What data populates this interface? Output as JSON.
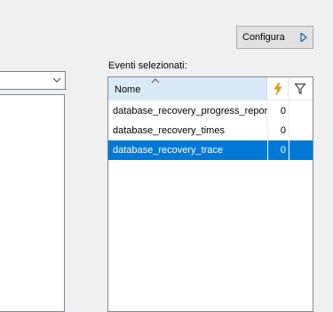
{
  "config_button": {
    "label": "Configura"
  },
  "selected_events": {
    "label": "Eventi selezionati:",
    "columns": {
      "name": "Nome"
    },
    "rows": [
      {
        "name": "database_recovery_progress_report",
        "count": "0",
        "selected": false
      },
      {
        "name": "database_recovery_times",
        "count": "0",
        "selected": false
      },
      {
        "name": "database_recovery_trace",
        "count": "0",
        "selected": true
      }
    ]
  },
  "colors": {
    "selection": "#0078d7",
    "header_active": "#d9ebf9",
    "flash_icon": "#f0a30a"
  },
  "icons": [
    "chevron-down-icon",
    "play-arrow-icon",
    "lightning-icon",
    "filter-icon",
    "sort-caret-icon"
  ]
}
